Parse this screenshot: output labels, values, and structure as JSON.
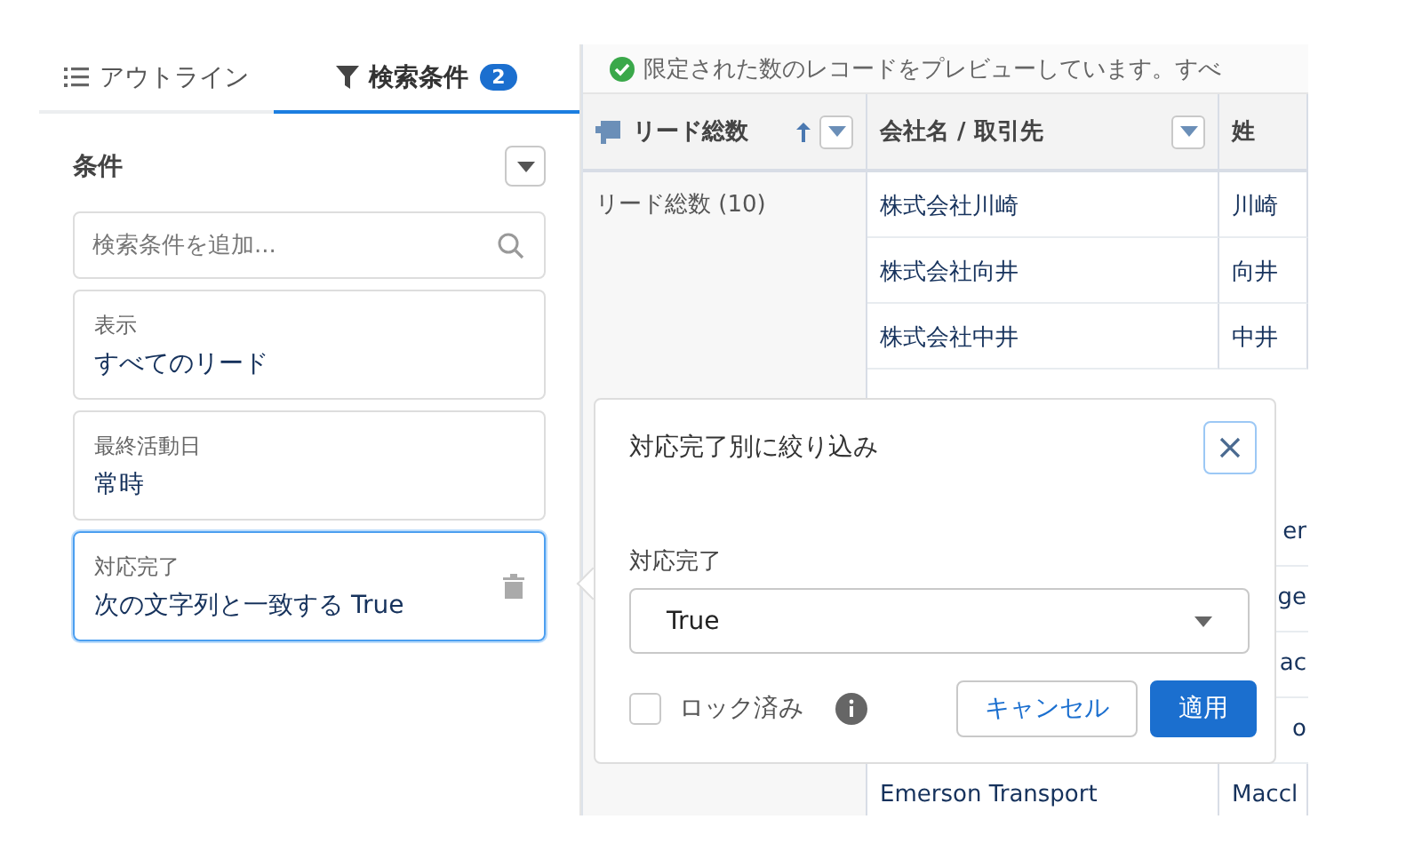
{
  "tabs": [
    {
      "label": "アウトライン",
      "kind": "outline",
      "selected": false
    },
    {
      "label": "検索条件",
      "kind": "filter",
      "badge": "2",
      "selected": true
    }
  ],
  "filters": {
    "title": "条件",
    "search": {
      "placeholder": "検索条件を追加..."
    },
    "items": [
      {
        "label": "表示",
        "value": "すべてのリード",
        "selected": false
      },
      {
        "label": "最終活動日",
        "value": "常時",
        "selected": false
      },
      {
        "label": "対応完了",
        "value": "次の文字列と一致する True",
        "selected": true
      }
    ]
  },
  "notice": "限定された数のレコードをプレビューしています。すべ",
  "table": {
    "columns": [
      {
        "label": "リード総数",
        "sorted": true,
        "menu": true
      },
      {
        "label": "会社名 / 取引先",
        "sorted": false,
        "menu": true
      },
      {
        "label": "姓",
        "sorted": false,
        "menu": false
      }
    ],
    "group": "リード総数 (10)",
    "rows": [
      {
        "company": "株式会社川崎",
        "last_name": "川崎",
        "partial": false
      },
      {
        "company": "株式会社向井",
        "last_name": "向井",
        "partial": false
      },
      {
        "company": "株式会社中井",
        "last_name": "中井",
        "partial": false
      },
      {
        "last_name": "er",
        "partial": true
      },
      {
        "last_name": "ge",
        "partial": true
      },
      {
        "last_name": "ac",
        "partial": true
      },
      {
        "last_name": "o",
        "partial": true
      },
      {
        "company": "Emerson Transport",
        "last_name": "Maccl",
        "partial": false
      }
    ]
  },
  "popover": {
    "title": "対応完了別に絞り込み",
    "field_label": "対応完了",
    "value": "True",
    "locked": {
      "label": "ロック済み",
      "checked": false
    },
    "buttons": [
      {
        "label": "キャンセル",
        "kind": "neutral"
      },
      {
        "label": "適用",
        "kind": "brand"
      }
    ]
  }
}
